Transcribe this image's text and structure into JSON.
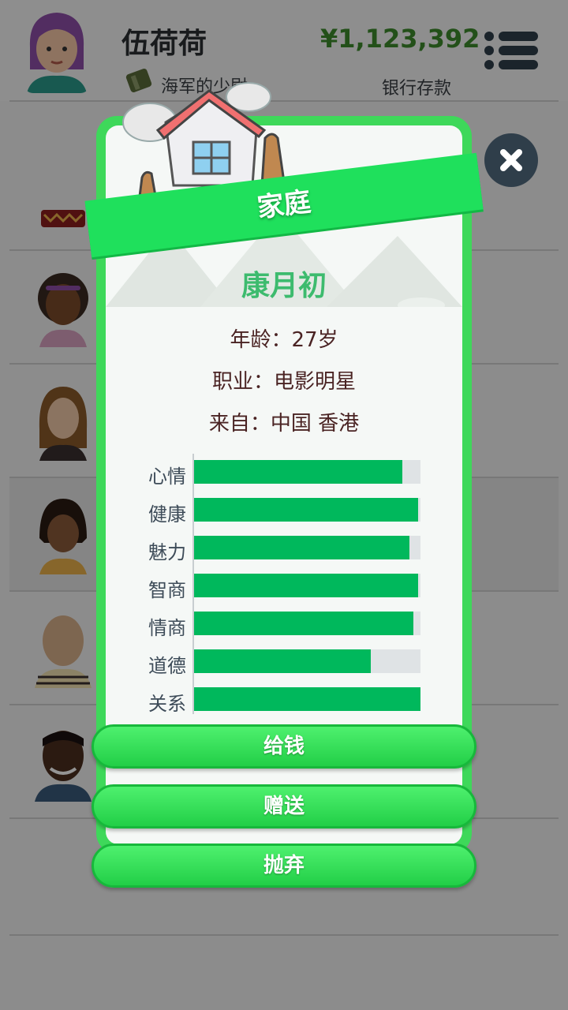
{
  "header": {
    "player_name": "伍荷荷",
    "rank": "海军的少尉",
    "money": "¥1,123,392",
    "money_label": "银行存款"
  },
  "modal": {
    "banner_title": "家庭",
    "person": {
      "name": "康月初",
      "age_label": "年龄：",
      "age_value": "27岁",
      "job_label": "职业：",
      "job_value": "电影明星",
      "origin_label": "来自：",
      "origin_value": "中国 香港"
    },
    "stats": [
      {
        "label": "心情",
        "value": 0.92
      },
      {
        "label": "健康",
        "value": 0.99
      },
      {
        "label": "魅力",
        "value": 0.95
      },
      {
        "label": "智商",
        "value": 0.99
      },
      {
        "label": "情商",
        "value": 0.97
      },
      {
        "label": "道德",
        "value": 0.78
      },
      {
        "label": "关系",
        "value": 1.0
      }
    ],
    "buttons": {
      "give_money": "给钱",
      "gift": "赠送",
      "abandon": "抛弃"
    }
  },
  "colors": {
    "accent_green": "#1fe05c",
    "bar_fill": "#00b85c",
    "name_color": "#3dbb6e",
    "money_color": "#3d8a2c"
  },
  "icons": [
    "menu-icon",
    "close-icon",
    "house-icon",
    "rank-icon"
  ]
}
